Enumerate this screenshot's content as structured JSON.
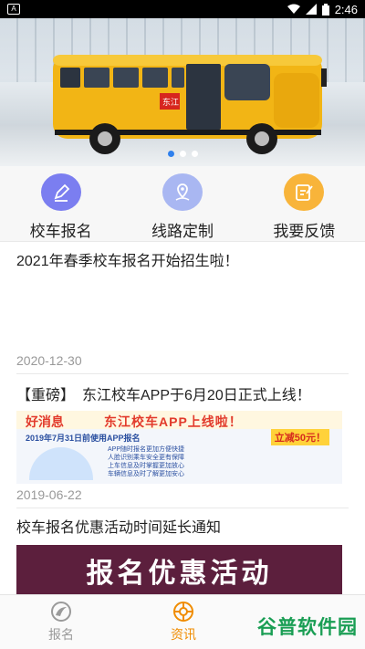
{
  "status_bar": {
    "time": "2:46",
    "left_indicator": "A"
  },
  "banner": {
    "slide_count": 3,
    "active_index": 0
  },
  "shortcuts": [
    {
      "label": "校车报名",
      "icon": "edit-icon",
      "color": "#7b7ef0"
    },
    {
      "label": "线路定制",
      "icon": "map-pin-icon",
      "color": "#a9b7f2"
    },
    {
      "label": "我要反馈",
      "icon": "feedback-icon",
      "color": "#f8b43a"
    }
  ],
  "news": [
    {
      "title": "2021年春季校车报名开始招生啦！",
      "date": "2020-12-30"
    },
    {
      "title": "【重磅】　东江校车APP于6月20日正式上线！",
      "date": "2019-06-22",
      "promo": {
        "headline": "好消息",
        "sub_headline": "东江校车APP上线啦！",
        "line": "2019年7月31日前使用APP报名",
        "discount": "立减50元！",
        "benefits": [
          "APP随时报名更加方便快捷",
          "人脸识别乘车安全更有保障",
          "上车信息及时掌握更加放心",
          "车辆信息及时了解更加安心"
        ]
      }
    },
    {
      "title": "校车报名优惠活动时间延长通知",
      "banner_text": "报名优惠活动"
    }
  ],
  "bottom_nav": [
    {
      "label": "报名",
      "active": false
    },
    {
      "label": "资讯",
      "active": true
    }
  ],
  "watermark": "谷普软件园"
}
